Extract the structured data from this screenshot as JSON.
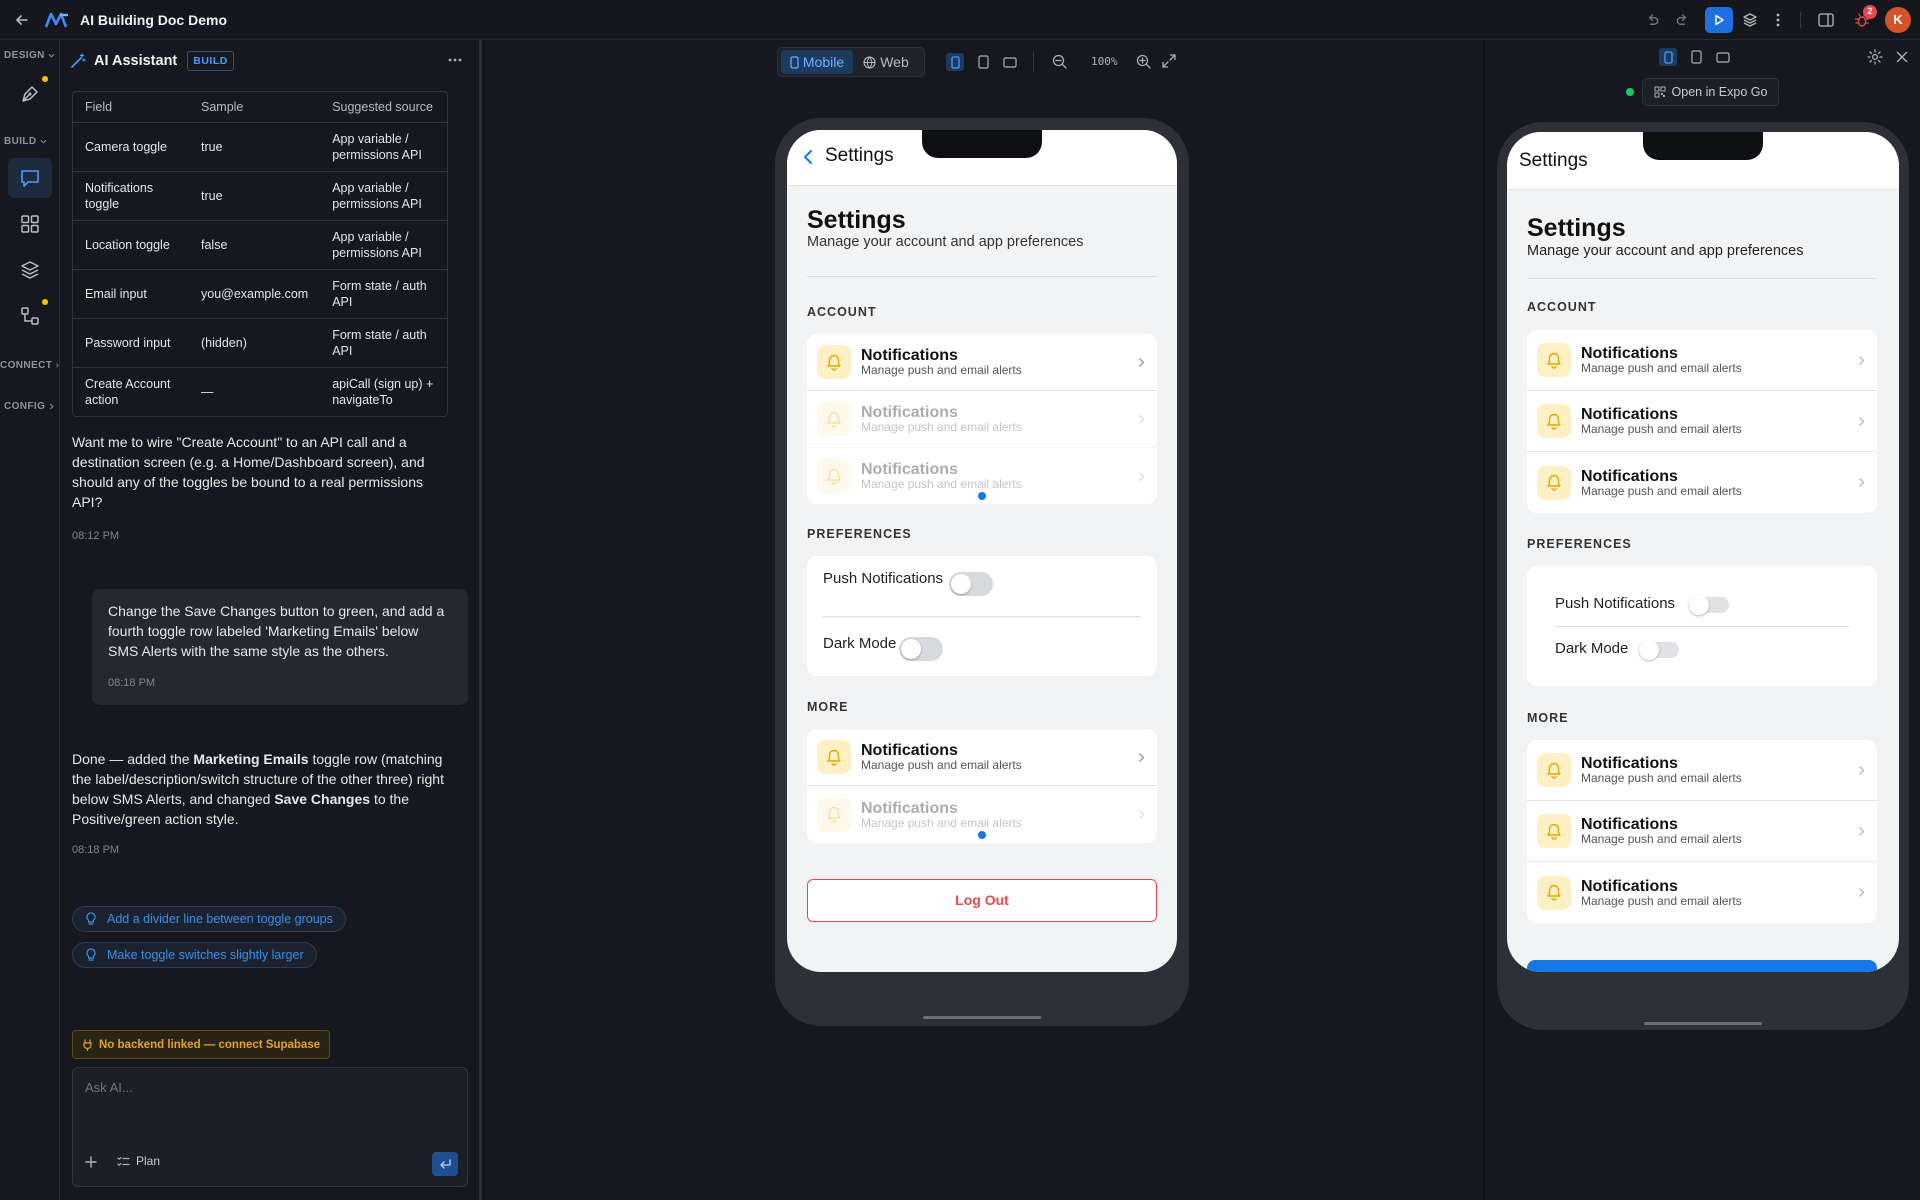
{
  "app": {
    "title": "AI Building Doc Demo",
    "notification_count": "2",
    "avatar_initial": "K"
  },
  "rail": {
    "design_label": "DESIGN",
    "build_label": "BUILD",
    "connect_label": "CONNECT",
    "config_label": "CONFIG"
  },
  "chat": {
    "header_title": "AI Assistant",
    "header_badge": "BUILD",
    "table": {
      "headers": [
        "Field",
        "Sample",
        "Suggested source"
      ],
      "rows": [
        [
          "Camera toggle",
          "true",
          "App variable / permissions API"
        ],
        [
          "Notifications toggle",
          "true",
          "App variable / permissions API"
        ],
        [
          "Location toggle",
          "false",
          "App variable / permissions API"
        ],
        [
          "Email input",
          "you@example.com",
          "Form state / auth API"
        ],
        [
          "Password input",
          "(hidden)",
          "Form state / auth API"
        ],
        [
          "Create Account action",
          "—",
          "apiCall (sign up) + navigateTo"
        ]
      ]
    },
    "assistant_msg_1": "Want me to wire \"Create Account\" to an API call and a destination screen (e.g. a Home/Dashboard screen), and should any of the toggles be bound to a real permissions API?",
    "time_1": "08:12 PM",
    "user_msg": "Change the Save Changes button to green, and add a fourth toggle row labeled 'Marketing Emails' below SMS Alerts with the same style as the others.",
    "time_2": "08:18 PM",
    "assistant_msg_2": {
      "p1": "Done — added the ",
      "b1": "Marketing Emails",
      "p2": " toggle row (matching the label/description/switch structure of the other three) right below SMS Alerts, and changed ",
      "b2": "Save Changes",
      "p3": " to the Positive/green action style."
    },
    "time_3": "08:18 PM",
    "suggestions": [
      "Add a divider line between toggle groups",
      "Make toggle switches slightly larger"
    ],
    "warning": "No backend linked — connect Supabase",
    "input_placeholder": "Ask AI...",
    "plan_label": "Plan"
  },
  "canvas": {
    "mobile_label": "Mobile",
    "web_label": "Web",
    "zoom": "100%"
  },
  "preview": {
    "expo_label": "Open in Expo Go"
  },
  "screen": {
    "nav_title": "Settings",
    "title": "Settings",
    "subtitle": "Manage your account and app preferences",
    "account_label": "ACCOUNT",
    "preferences_label": "PREFERENCES",
    "more_label": "MORE",
    "row_title": "Notifications",
    "row_sub": "Manage push and email alerts",
    "push_label": "Push Notifications",
    "dark_label": "Dark Mode",
    "logout_label": "Log Out"
  },
  "colors": {
    "accent": "#1677e6",
    "danger": "#e5484d",
    "bell_bg": "#fdf0c4",
    "bell_fg": "#e0a800"
  }
}
